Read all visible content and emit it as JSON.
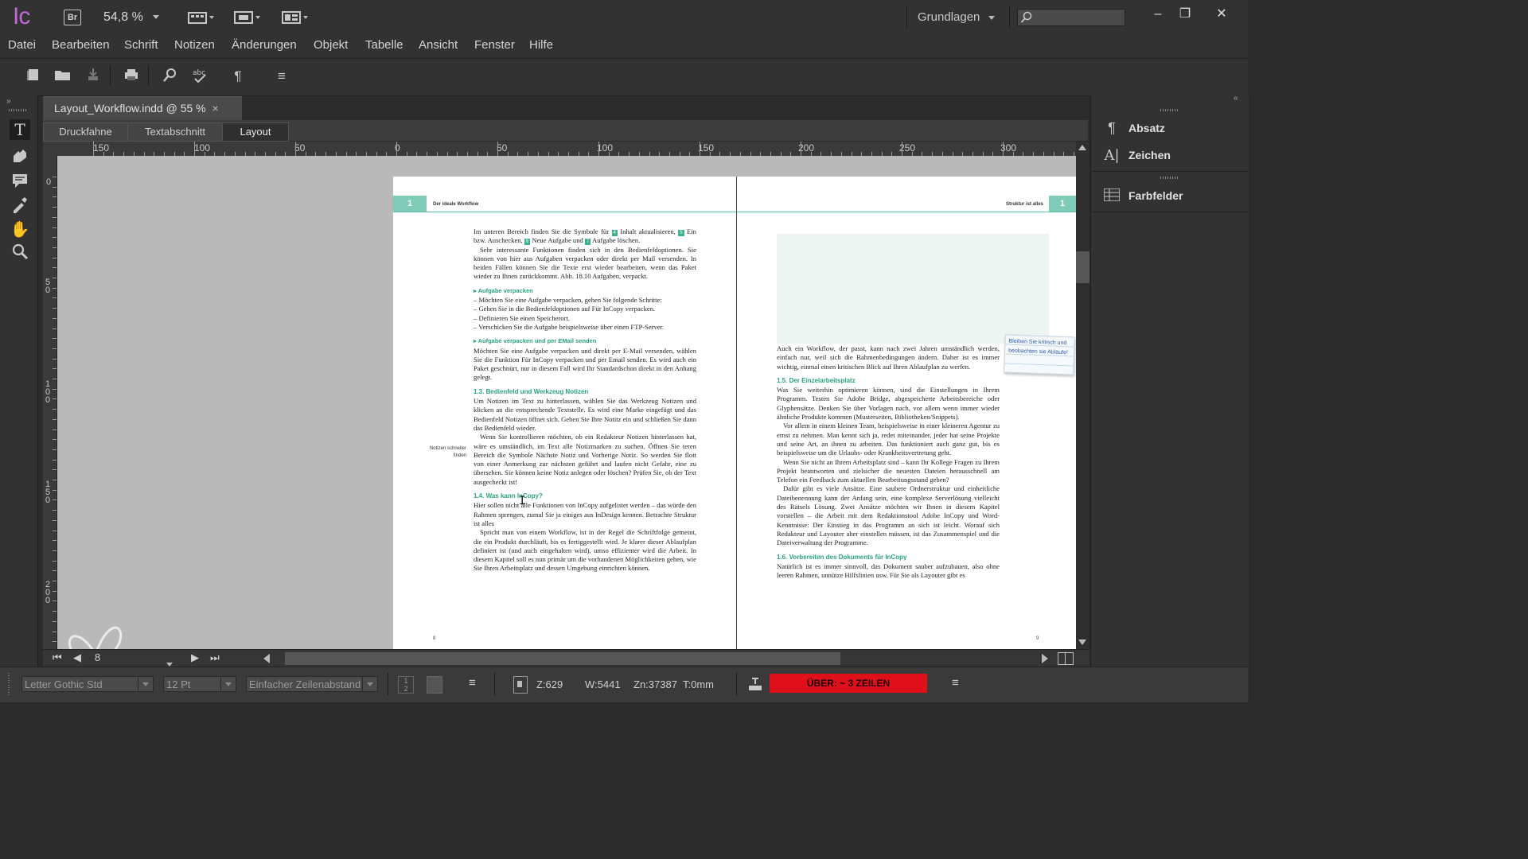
{
  "app": {
    "logo": "Ic",
    "bridge_label": "Br",
    "zoom_level": "54,8 %",
    "workspace": "Grundlagen",
    "search_placeholder": ""
  },
  "window_controls": {
    "minimize": "–",
    "restore": "❐",
    "close": "✕"
  },
  "menu": [
    "Datei",
    "Bearbeiten",
    "Schrift",
    "Notizen",
    "Änderungen",
    "Objekt",
    "Tabelle",
    "Ansicht",
    "Fenster",
    "Hilfe"
  ],
  "document_tab": {
    "title": "Layout_Workflow.indd @ 55 %",
    "close": "×"
  },
  "view_tabs": [
    "Druckfahne",
    "Textabschnitt",
    "Layout"
  ],
  "active_view_tab": 2,
  "ruler_h_labels": [
    "150",
    "100",
    "50",
    "0",
    "50",
    "100",
    "150",
    "200",
    "250",
    "300"
  ],
  "ruler_v_labels": [
    "0",
    "50",
    "100",
    "150",
    "200"
  ],
  "left_page": {
    "chapter": "1",
    "running_head": "Der ideale Workflow",
    "page_number": "8",
    "margin_note": "Notizen schneller finden",
    "intro_line1_pre": "Im unteren Bereich finden Sie die Symbole für",
    "intro_b4": "4",
    "intro_line1_post": "Inhalt aktualisieren,",
    "intro_b5": "5",
    "intro_line2a": "Ein bzw. Auschecken,",
    "intro_b6": "6",
    "intro_line2b": "Neue Aufgabe und",
    "intro_b7": "7",
    "intro_line2c": "Aufgabe löschen.",
    "intro_p2": "Sehr interessante Funktionen finden sich in den Bedienfeldoptionen. Sie können von hier aus Aufgaben verpacken oder direkt per Mail versenden. In beiden Fällen können Sie die Texte erst wieder bearbeiten, wenn das Paket wieder zu Ihnen zurückkommt. Abb. 18.10 Aufgaben, verpackt.",
    "bullet1_head": "▸  Aufgabe verpacken",
    "bullet1_items": [
      "–  Möchten Sie eine Aufgabe verpacken, gehen Sie folgende Schritte:",
      "–  Gehen Sie in die Bedienfeldoptionen auf Für InCopy verpacken.",
      "–  Definieren Sie einen Speicherort.",
      "–  Verschicken Sie die Aufgabe beispielsweise über einen FTP-Server."
    ],
    "bullet2_head": "▸  Aufgabe verpacken und per EMail senden",
    "bullet2_text": "Möchten Sie eine Aufgabe verpacken und direkt per E-Mail versenden, wählen Sie die Funktion Für InCopy verpacken und per Email senden. Es wird auch ein Paket geschnürt, nur in diesem Fall wird Ihr Standardschon direkt in den Anhang gelegt.",
    "h13": "1.3.  Bedienfeld und Werkzeug Notizen",
    "p13a": "Um Notizen im Text zu hinterlassen, wählen Sie das Werkzeug Notizen und klicken an die entsprechende Textstelle. Es wird eine Marke eingefügt und das Bedienfeld Notizen öffnet sich. Geben Sie Ihre Notitz ein und schließen Sie dann das Bedienfeld wieder.",
    "p13b": "Wenn Sie kontrollieren möchten, ob ein Redakteur Notizen hinterlassen hat, wäre es umständlich, im Text alle Notizmarken zu suchen. Öffnen Sie teren Bereich die Symbole Nächste Notiz und Vorherige Notiz. So werden Sie flott von einer Anmerkung zur nächsten geführt und laufen nicht Gefahr, eine zu übersehen. Sie können keine Notiz anlegen oder löschen? Prüfen Sie, ob der Text ausgecheckt ist!",
    "h14": "1.4.  Was kann InCopy?",
    "p14a": "Hier sollen nicht alle Funktionen von InCopy aufgelistet werden – das würde den Rahmen sprengen, zumal Sie ja einiges aus InDesign kennen. Betrachte Struktur ist alles",
    "p14b": "Spricht man von einem Workflow, ist in der Regel die Schriftfolge gemeint, die ein Produkt durchläuft, bis es fertiggestellt wird. Je klarer dieser Ablaufplan definiert ist (und auch eingehalten wird), umso effizienter wird die Arbeit. In diesem Kapitel soll es nun primär um die vorhandenen Möglichkeiten gehen, wie Sie Ihren Arbeitsplatz und dessen Umgebung einrichten können."
  },
  "right_page": {
    "chapter": "1",
    "running_head": "Struktur ist alles",
    "page_number": "9",
    "sticky_note": "Bleiben Sie kritisch und beobachten sie Abläufe!",
    "p1": "Auch ein Workflow, der passt, kann nach zwei Jahren umständlich werden, einfach nur, weil sich die Rahmenbedingungen ändern. Daher ist es immer wichtig, einmal einen kritischen Blick auf Ihren Ablaufplan zu werfen.",
    "h15": "1.5.  Der Einzelarbeitsplatz",
    "p15a": "Was Sie weiterhin optimieren können, sind die Einstellungen in Ihrem Programm. Testen Sie Adobe Bridge, abgespeicherte Arbeitsbereiche oder Glyphensätze. Denken Sie über Vorlagen nach, vor allem wenn immer wieder ähnliche Produkte kommen (Musterseiten, Bibliotheken/Snippets).",
    "p15b": "Vor allem in einem kleinen Team, beispielsweise in einer kleineren Agentur zu ernst zu nehmen. Man kennt sich ja, redet miteinander, jeder hat seine Projekte und seine Art, an ihnen zu arbeiten. Das funktioniert auch ganz gut, bis es beispielsweise um die Urlaubs- oder Krankheitsvertretung geht.",
    "p15c": "Wenn Sie nicht an Ihrem Arbeitsplatz sind – kann Ihr Kollege Fragen zu Ihrem Projekt beantworten und zielsicher die neuesten Dateien herausschnell am Telefon ein Feedback zum aktuellen Bearbeitungsstand geben?",
    "p15d": "Dafür gibt es viele Ansätze. Eine saubere Ordnerstruktur und einheitliche Dateibenennung kann der Anfang sein, eine komplexe Serverlösung vielleicht des Rätsels Lösung. Zwei Ansätze möchten wir Ihnen in diesem Kapitel vorstellen – die Arbeit mit dem Redaktionstool Adobe InCopy und Word-Kenntnisse: Der Einstieg in das Programm an sich ist leicht. Worauf sich Redakteur und Layouter aber einstellen müssen, ist das Zusammenspiel und die Dateiverwaltung der Programme.",
    "h16": "1.6.  Vorbereiten des Dokuments für InCopy",
    "p16": "Natürlich ist es immer sinnvoll, das Dokument sauber aufzubauen, also ohne leeren Rahmen, unnütze Hilfslinien usw. Für Sie als Layouter gibt es"
  },
  "page_nav": {
    "page": "8"
  },
  "right_panel": {
    "items": [
      "Absatz",
      "Zeichen",
      "Farbfelder"
    ]
  },
  "status": {
    "font": "Letter Gothic Std",
    "size": "12 Pt",
    "leading": "Einfacher Zeilenabstand",
    "z": "Z:629",
    "w": "W:5441",
    "zn": "Zn:37387",
    "t": "T:0mm",
    "overset": "ÜBER:  ~ 3 ZEILEN"
  },
  "colors": {
    "accent": "#2aa37f",
    "overset": "#e0101a",
    "logo": "#c06ad8"
  }
}
